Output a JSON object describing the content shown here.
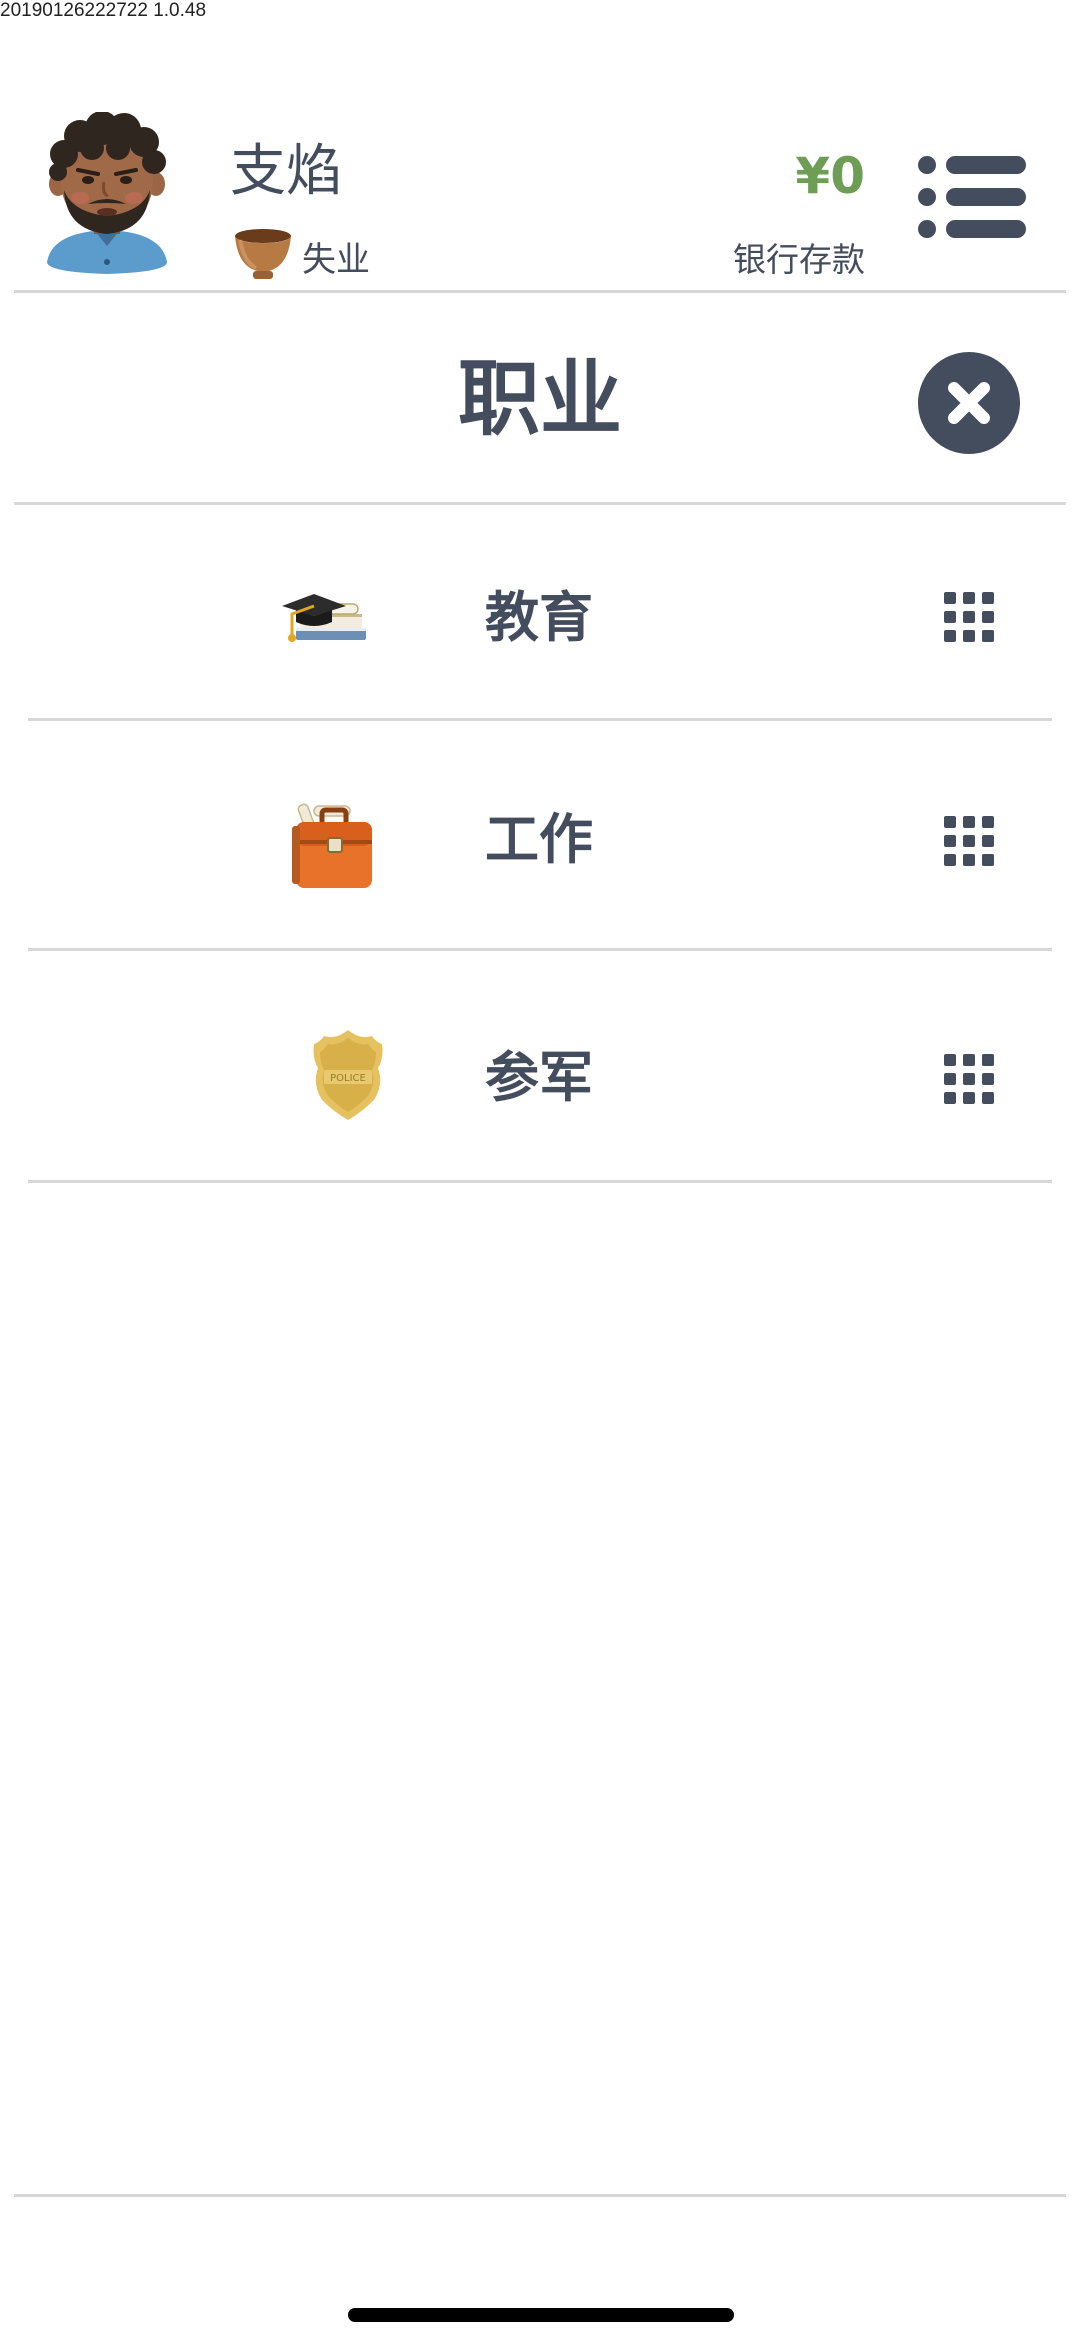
{
  "build_stamp": "20190126222722 1.0.48",
  "header": {
    "player_name": "支焰",
    "job_status": "失业",
    "money": "¥0",
    "money_label": "银行存款",
    "avatar_icon": "avatar-icon",
    "job_icon": "bowl-icon",
    "menu_icon": "list-menu-icon"
  },
  "careers_panel": {
    "title": "职业",
    "close_icon": "close-icon",
    "items": [
      {
        "label": "教育",
        "icon": "graduation-cap-icon"
      },
      {
        "label": "工作",
        "icon": "briefcase-icon"
      },
      {
        "label": "参军",
        "icon": "police-badge-icon"
      }
    ],
    "item_action_icon": "grid-icon"
  },
  "colors": {
    "text_primary": "#444d5e",
    "money_green": "#6e9e55",
    "divider": "#d8d8d8",
    "close_button_bg": "#444d5e"
  }
}
